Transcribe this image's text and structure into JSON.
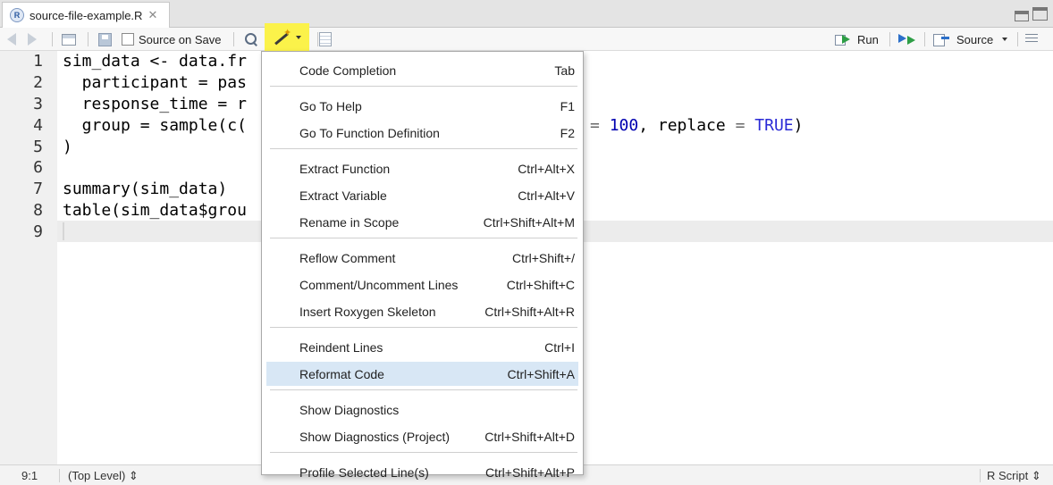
{
  "tab": {
    "title": "source-file-example.R",
    "close": "✕",
    "file_icon": "R"
  },
  "toolbar": {
    "source_on_save": "Source on Save",
    "run": "Run",
    "source": "Source"
  },
  "editor": {
    "line_numbers": [
      "1",
      "2",
      "3",
      "4",
      "5",
      "6",
      "7",
      "8",
      "9"
    ],
    "lines": [
      "sim_data <- data.fr",
      "  participant = pas",
      "  response_time = r",
      "  group = sample(c(",
      ")",
      "",
      "summary(sim_data)",
      "table(sim_data$grou",
      ""
    ],
    "line4_tail": {
      "eq1": "=",
      "n": "100",
      "comma": ", replace ",
      "eq2": "=",
      "true": "TRUE",
      "close": ")"
    }
  },
  "menu": {
    "groups": [
      [
        {
          "label": "Code Completion",
          "shortcut": "Tab"
        }
      ],
      [
        {
          "label": "Go To Help",
          "shortcut": "F1"
        },
        {
          "label": "Go To Function Definition",
          "shortcut": "F2"
        }
      ],
      [
        {
          "label": "Extract Function",
          "shortcut": "Ctrl+Alt+X"
        },
        {
          "label": "Extract Variable",
          "shortcut": "Ctrl+Alt+V"
        },
        {
          "label": "Rename in Scope",
          "shortcut": "Ctrl+Shift+Alt+M"
        }
      ],
      [
        {
          "label": "Reflow Comment",
          "shortcut": "Ctrl+Shift+/"
        },
        {
          "label": "Comment/Uncomment Lines",
          "shortcut": "Ctrl+Shift+C"
        },
        {
          "label": "Insert Roxygen Skeleton",
          "shortcut": "Ctrl+Shift+Alt+R"
        }
      ],
      [
        {
          "label": "Reindent Lines",
          "shortcut": "Ctrl+I"
        },
        {
          "label": "Reformat Code",
          "shortcut": "Ctrl+Shift+A",
          "selected": true
        }
      ],
      [
        {
          "label": "Show Diagnostics",
          "shortcut": ""
        },
        {
          "label": "Show Diagnostics (Project)",
          "shortcut": "Ctrl+Shift+Alt+D"
        }
      ],
      [
        {
          "label": "Profile Selected Line(s)",
          "shortcut": "Ctrl+Shift+Alt+P"
        }
      ]
    ]
  },
  "status": {
    "position": "9:1",
    "scope": "(Top Level) ⇕",
    "file_type": "R Script ⇕"
  },
  "colors": {
    "highlight": "#fbf24a",
    "menu_selected": "#d8e7f5",
    "keyword": "#2a2ad6"
  }
}
